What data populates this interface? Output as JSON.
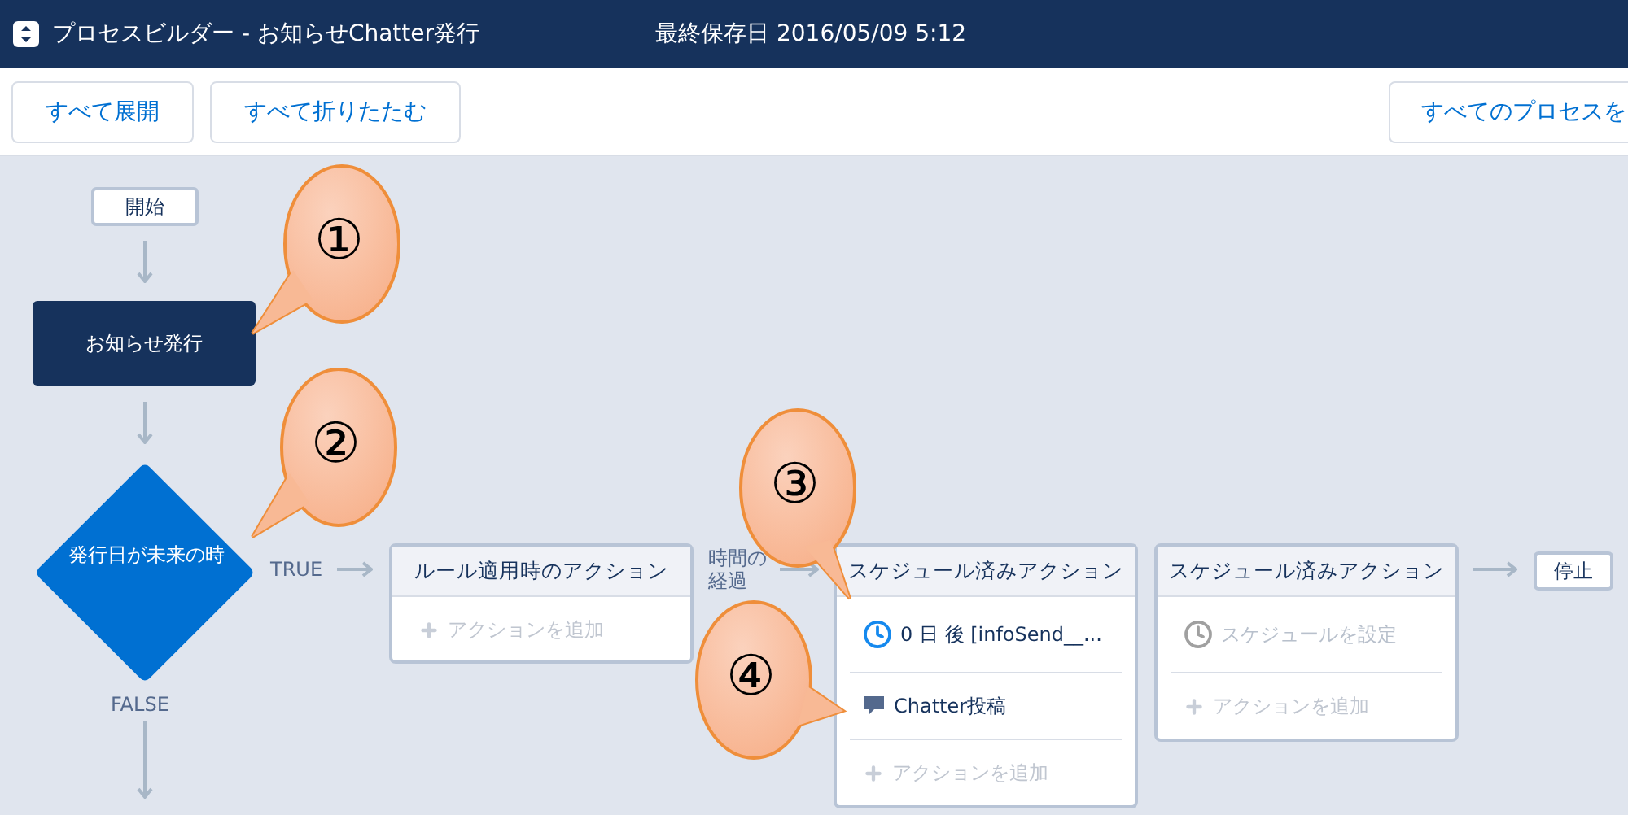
{
  "header": {
    "title": "プロセスビルダー - お知らせChatter発行",
    "saved": "最終保存日 2016/05/09 5:12"
  },
  "toolbar": {
    "buttons": [
      "すべて展開",
      "すべて折りたたむ"
    ],
    "right_button": "すべてのプロセスを"
  },
  "flow": {
    "start": "開始",
    "criteria_node": "お知らせ発行",
    "decision": "発行日が未来の時",
    "true_label": "TRUE",
    "false_label": "FALSE",
    "immediate": {
      "title": "ルール適用時のアクション",
      "rows": [
        {
          "kind": "add",
          "text": "アクションを追加"
        }
      ]
    },
    "delay_label": "時間の経過",
    "scheduled": [
      {
        "title": "スケジュール済みアクション",
        "rows": [
          {
            "kind": "schedule",
            "text": "0 日 後 [infoSend__...",
            "set": true
          },
          {
            "kind": "action",
            "text": "Chatter投稿"
          },
          {
            "kind": "add",
            "text": "アクションを追加"
          }
        ]
      },
      {
        "title": "スケジュール済みアクション",
        "rows": [
          {
            "kind": "schedule",
            "text": "スケジュールを設定",
            "set": false
          },
          {
            "kind": "add",
            "text": "アクションを追加"
          }
        ]
      }
    ],
    "stop": "停止"
  },
  "callouts": [
    "①",
    "②",
    "③",
    "④"
  ]
}
